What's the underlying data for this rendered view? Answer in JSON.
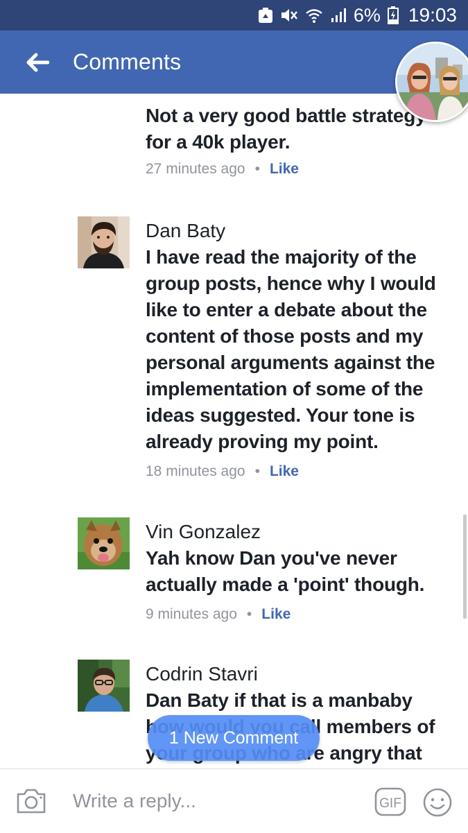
{
  "status_bar": {
    "battery_text": "6%",
    "time": "19:03",
    "icons": [
      "recycle-icon",
      "mute-icon",
      "wifi-icon",
      "signal-icon",
      "battery-charging-icon"
    ]
  },
  "header": {
    "title": "Comments",
    "back_icon": "arrow-left-icon"
  },
  "comments": [
    {
      "name": "",
      "text": "Not a very good battle strategy for a 40k player.",
      "time": "27 minutes ago",
      "dot": "•",
      "like": "Like"
    },
    {
      "name": "Dan Baty",
      "text": "I have read the majority of the group posts, hence why I would like to enter a debate about the content of those posts and my personal arguments against the implementation of some of the ideas suggested. Your tone is already proving my point.",
      "time": "18 minutes ago",
      "dot": "•",
      "like": "Like"
    },
    {
      "name": "Vin Gonzalez",
      "text": "Yah know Dan you've never actually made a 'point' though.",
      "time": "9 minutes ago",
      "dot": "•",
      "like": "Like"
    },
    {
      "name": "Codrin Stavri",
      "text": "Dan Baty if that is a manbaby how would you call members of your group who are angry that",
      "time": "",
      "dot": "",
      "like": ""
    }
  ],
  "new_comment_pill": "1 New Comment",
  "composer": {
    "placeholder": "Write a reply...",
    "gif_label": "GIF",
    "camera_icon": "camera-icon",
    "emoji_icon": "smiley-icon"
  },
  "colors": {
    "status_bar": "#2f4477",
    "header": "#4267b2",
    "link": "#4267b2",
    "meta": "#90949c",
    "pill": "#548df5"
  }
}
